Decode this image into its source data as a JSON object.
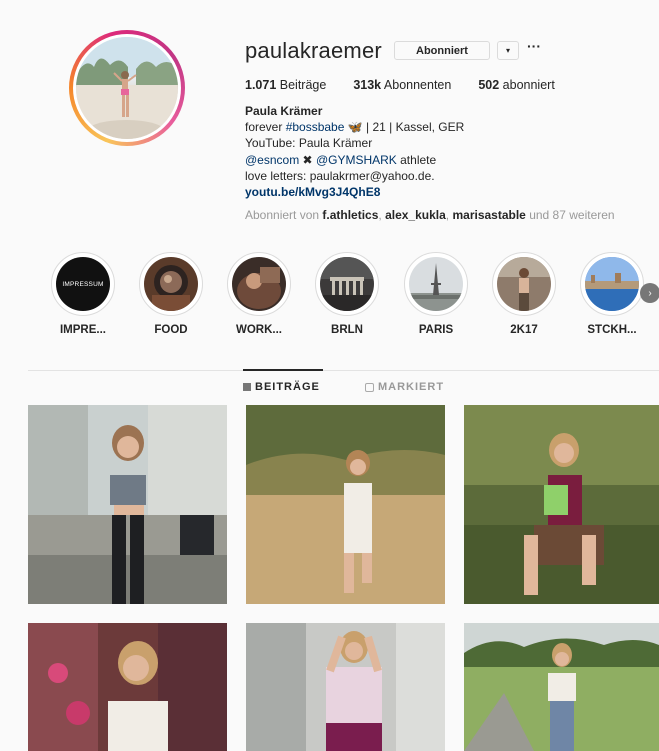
{
  "profile": {
    "username": "paulakraemer",
    "follow_button": "Abonniert",
    "dropdown": "▾",
    "more": "···",
    "stats": [
      {
        "count": "1.071",
        "label": " Beiträge"
      },
      {
        "count": "313k",
        "label": " Abonnenten"
      },
      {
        "count": "502",
        "label": " abonniert"
      }
    ],
    "bio": {
      "name": "Paula Krämer",
      "line1_a": "forever ",
      "line1_tag": "#bossbabe",
      "line1_emoji": "🦋",
      "line1_b": " | 21 | Kassel, GER",
      "line2": "YouTube: Paula Krämer",
      "line3_a": "@esncom",
      "line3_x": " ✖ ",
      "line3_b": "@GYMSHARK",
      "line3_c": " athlete",
      "line4": "love letters: paulakrmer@yahoo.de.",
      "link": "youtu.be/kMvg3J4QhE8"
    },
    "followed_by": {
      "prefix": "Abonniert von ",
      "user1": "f.athletics",
      "sep1": ", ",
      "user2": "alex_kukla",
      "sep2": ", ",
      "user3": "marisastable",
      "suffix": " und 87 weiteren"
    }
  },
  "highlights": [
    {
      "label": "IMPRE...",
      "inner_text": "IMPRESSUM"
    },
    {
      "label": "FOOD"
    },
    {
      "label": "WORK..."
    },
    {
      "label": "BRLN"
    },
    {
      "label": "PARIS"
    },
    {
      "label": "2K17"
    },
    {
      "label": "STCKH..."
    }
  ],
  "tabs": {
    "posts": "BEITRÄGE",
    "tagged": "MARKIERT"
  },
  "icons": {
    "next": "›"
  }
}
